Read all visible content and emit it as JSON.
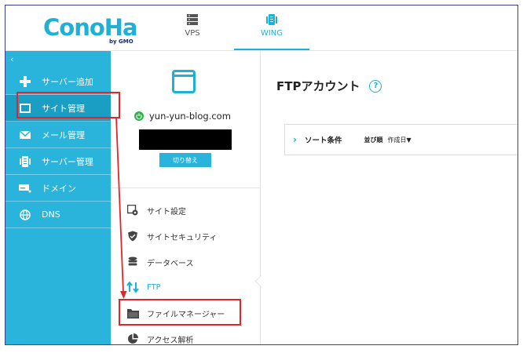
{
  "header": {
    "logo": "ConoHa",
    "logo_sub": "by GMO",
    "tabs": [
      {
        "label": "VPS"
      },
      {
        "label": "WING"
      }
    ]
  },
  "sidebar": {
    "collapse": "‹",
    "items": [
      {
        "label": "サーバー追加",
        "icon": "plus-icon"
      },
      {
        "label": "サイト管理",
        "icon": "window-icon"
      },
      {
        "label": "メール管理",
        "icon": "mail-icon"
      },
      {
        "label": "サーバー管理",
        "icon": "server-icon"
      },
      {
        "label": "ドメイン",
        "icon": "domain-icon"
      },
      {
        "label": "DNS",
        "icon": "globe-icon"
      }
    ]
  },
  "site_panel": {
    "domain": "yun-yun-blog.com",
    "switch_button": "切り替え",
    "menu": [
      {
        "label": "サイト設定",
        "icon": "settings-icon"
      },
      {
        "label": "サイトセキュリティ",
        "icon": "shield-icon"
      },
      {
        "label": "データベース",
        "icon": "database-icon"
      },
      {
        "label": "FTP",
        "icon": "ftp-arrows-icon"
      },
      {
        "label": "ファイルマネージャー",
        "icon": "folder-icon"
      },
      {
        "label": "アクセス解析",
        "icon": "pie-chart-icon"
      }
    ]
  },
  "main": {
    "title": "FTPアカウント",
    "help": "?",
    "sort": {
      "chevron": "›",
      "condition_label": "ソート条件",
      "order_label": "並び順",
      "order_value": "作成日▼"
    }
  },
  "colors": {
    "accent": "#2ab4dc",
    "annotation": "#e0262b"
  }
}
